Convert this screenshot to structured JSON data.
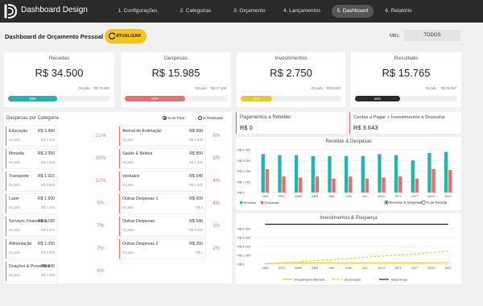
{
  "app": {
    "title": "Dashboard Design"
  },
  "nav": {
    "tabs": [
      {
        "label": "1. Configurações",
        "active": false
      },
      {
        "label": "2. Categorias",
        "active": false
      },
      {
        "label": "3. Orçamento",
        "active": false
      },
      {
        "label": "4. Lançamentos",
        "active": false
      },
      {
        "label": "5. Dashboard",
        "active": true
      },
      {
        "label": "6. Relatório",
        "active": false
      }
    ]
  },
  "header": {
    "title": "Dashboard de Orçamento Pessoal",
    "update_label": "ATUALIZAR",
    "month_label": "Mês:",
    "month_value": "TODOS"
  },
  "kpis": [
    {
      "title": "Receitas",
      "value": "R$ 34.500",
      "orcado_label": "Orçado:",
      "orcado": "R$ 72.000",
      "pct_label": "48%",
      "pct": 0.48,
      "color": "#1bb8b0"
    },
    {
      "title": "Despesas",
      "value": "R$ 15.985",
      "orcado_label": "Orçado:",
      "orcado": "R$ 27.100",
      "pct_label": "59%",
      "pct": 0.59,
      "color": "#f26b6b"
    },
    {
      "title": "Investimentos",
      "value": "R$ 2.750",
      "orcado_label": "Orçado:",
      "orcado": "R$ 9.000",
      "pct_label": "31%",
      "pct": 0.31,
      "color": "#f5c518"
    },
    {
      "title": "Resultado",
      "value": "R$ 15.765",
      "orcado_label": "Orçado:",
      "orcado": "R$ 35.897",
      "pct_label": "44%",
      "pct": 0.44,
      "color": "#2b2b2b"
    }
  ],
  "categories_panel": {
    "title": "Despesas por Categoria",
    "radio_total": "% do Total",
    "radio_realizado": "% Realizado",
    "orcado_label": "Orçado",
    "items": [
      {
        "name": "Educação",
        "value": "R$ 3.400",
        "orcado": "R$ 2.400",
        "pct": "21%"
      },
      {
        "name": "Moradia",
        "value": "R$ 2.350",
        "orcado": "R$ 1.500",
        "pct": "15%"
      },
      {
        "name": "Transporte",
        "value": "R$ 1.915",
        "orcado": "R$ 3.600",
        "pct": "12%"
      },
      {
        "name": "Lazer",
        "value": "R$ 1.500",
        "orcado": "R$ 2.400",
        "pct": "9%"
      },
      {
        "name": "Serviços Financeiros",
        "value": "R$ 1.100",
        "orcado": "R$ 1.200",
        "pct": "7%"
      },
      {
        "name": "Alimentação",
        "value": "R$ 1.050",
        "orcado": "R$ 6.000",
        "pct": "7%"
      },
      {
        "name": "Doações & Presentes",
        "value": "R$ 900",
        "orcado": "R$ 2.400",
        "pct": "6%"
      },
      {
        "name": "Animal de Estimação",
        "value": "R$ 890",
        "orcado": "R$ 2.500",
        "pct": "6%"
      },
      {
        "name": "Saúde & Beleza",
        "value": "R$ 850",
        "orcado": "R$ 1.200",
        "pct": "5%"
      },
      {
        "name": "Vestuário",
        "value": "R$ 640",
        "orcado": "R$ 1.800",
        "pct": "4%"
      },
      {
        "name": "Outras Despesas 1",
        "value": "R$ 600",
        "orcado": "R$ 2",
        "pct": "4%"
      },
      {
        "name": "Outras Despesas",
        "value": "R$ 540",
        "orcado": "R$ 3.000",
        "pct": "3%"
      },
      {
        "name": "Outras Despesas 2",
        "value": "R$ 250",
        "orcado": "R$ 1",
        "pct": "2%"
      }
    ]
  },
  "payments": [
    {
      "title": "Pagamentos a Rebeber",
      "value": "R$ 0",
      "color": "#1bb8b0"
    },
    {
      "title": "Contas a Pagar + Investimentos a Depositar",
      "value": "R$ 3.643",
      "color": "#f26b6b"
    }
  ],
  "chart_data": [
    {
      "type": "bar",
      "title": "Receitas & Despesas",
      "categories": [
        "JAN",
        "FEV",
        "MAR",
        "ABR",
        "MAI",
        "JUN",
        "JUL",
        "AGO",
        "SET",
        "OUT",
        "NOV",
        "DEZ"
      ],
      "y_ticks": [
        "R$ 4.000",
        "R$ 3.000",
        "R$ 2.000",
        "R$ 1.000",
        "R$ 0"
      ],
      "ylim": [
        0,
        4000
      ],
      "series": [
        {
          "name": "Receitas",
          "color": "#1bb8b0",
          "values": [
            3600,
            3500,
            3500,
            3400,
            3400,
            3400,
            3400,
            3600,
            3500,
            3000,
            3700,
            3800
          ]
        },
        {
          "name": "Despesas",
          "color": "#f26b6b",
          "values": [
            2200,
            1500,
            1400,
            1500,
            1300,
            1500,
            1300,
            1400,
            1500,
            1300,
            2200,
            2100
          ]
        }
      ],
      "legend": "bottom-left",
      "radio_both": "Receitas & Despesas",
      "radio_pct": "% de Receita"
    },
    {
      "type": "line",
      "title": "Investimentos & Poupança",
      "categories": [
        "JAN",
        "FEV",
        "MAR",
        "ABR",
        "MAI",
        "JUN",
        "JUL",
        "AGO",
        "SET",
        "OUT",
        "NOV",
        "DEZ"
      ],
      "y_ticks": [
        "R$ 8.000",
        "R$ 6.000",
        "R$ 4.000",
        "R$ 2.000",
        "R$ 0"
      ],
      "ylim": [
        0,
        8000
      ],
      "series": [
        {
          "name": "Investimento Mensal",
          "color": "#f5c518",
          "style": "solid",
          "values": [
            100,
            200,
            250,
            250,
            250,
            250,
            250,
            250,
            250,
            250,
            300,
            350
          ]
        },
        {
          "name": "Acumulado",
          "color": "#f5c518",
          "style": "dashed",
          "values": [
            100,
            300,
            550,
            800,
            1050,
            1300,
            1550,
            1800,
            2050,
            2300,
            2600,
            2950
          ]
        },
        {
          "name": "Meta Anual",
          "color": "#222222",
          "style": "solid",
          "values": [
            9000,
            9000,
            9000,
            9000,
            9000,
            9000,
            9000,
            9000,
            9000,
            9000,
            9000,
            9000
          ]
        }
      ],
      "legend": "bottom"
    }
  ]
}
